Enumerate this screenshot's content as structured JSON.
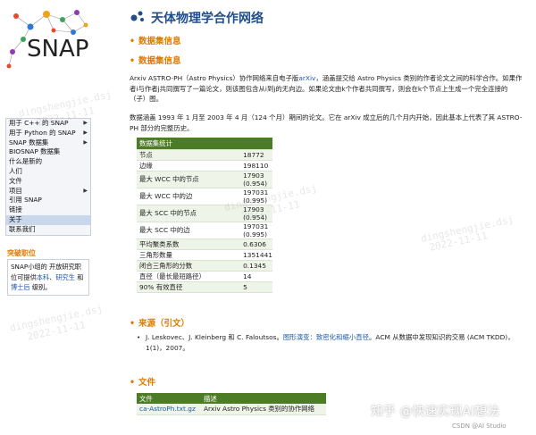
{
  "left": {
    "logo_text": "SNAP",
    "menu": [
      {
        "label": "用于 C++ 的 SNAP",
        "has_arrow": true
      },
      {
        "label": "用于 Python 的 SNAP",
        "has_arrow": true
      },
      {
        "label": "SNAP 数据集",
        "has_arrow": true
      },
      {
        "label": "BIOSNAP 数据集",
        "has_arrow": false
      },
      {
        "label": "什么是新的",
        "has_arrow": false
      },
      {
        "label": "人们",
        "has_arrow": false
      },
      {
        "label": "文件",
        "has_arrow": false
      },
      {
        "label": "项目",
        "has_arrow": true
      },
      {
        "label": "引用 SNAP",
        "has_arrow": false
      },
      {
        "label": "链接",
        "has_arrow": false
      },
      {
        "label": "关于",
        "has_arrow": false
      },
      {
        "label": "联系我们",
        "has_arrow": false
      }
    ],
    "news_title": "突破职位",
    "news_pre": "SNAP小组的 开放研究职位可提供",
    "news_link1": "本科",
    "news_sep": "、",
    "news_link2": "研究生",
    "news_mid": " 和 ",
    "news_link3": "博士后",
    "news_post": " 级别。"
  },
  "main": {
    "title": "天体物理学合作网络",
    "sec1": "数据集信息",
    "sec2": "数据集信息",
    "para1_a": "Arxiv ASTRO-PH（Astro Physics）协作网络来自电子版",
    "para1_link": "arXiv",
    "para1_b": "，涵盖提交给 Astro Physics 类别的作者论文之间的科学合作。如果作者i与作者j共同撰写了一篇论文，则该图包含从i到j的无向边。如果论文由k个作者共同撰写，则会在k个节点上生成一个完全连接的（子）图。",
    "para2": "数据涵盖 1993 年 1 月至 2003 年 4 月（124 个月）期间的论文。它在 arXiv 成立后的几个月内开始，因此基本上代表了其 ASTRO-PH 部分的完整历史。",
    "stats_header": "数据集统计",
    "stats": [
      {
        "k": "节点",
        "v": "18772"
      },
      {
        "k": "边缘",
        "v": "198110"
      },
      {
        "k": "最大 WCC 中的节点",
        "v": "17903 (0.954)"
      },
      {
        "k": "最大 WCC 中的边",
        "v": "197031 (0.995)"
      },
      {
        "k": "最大 SCC 中的节点",
        "v": "17903 (0.954)"
      },
      {
        "k": "最大 SCC 中的边",
        "v": "197031 (0.995)"
      },
      {
        "k": "平均聚类系数",
        "v": "0.6306"
      },
      {
        "k": "三角形数量",
        "v": "1351441"
      },
      {
        "k": "闭合三角形的分数",
        "v": "0.1345"
      },
      {
        "k": "直径（最长最短路径）",
        "v": "14"
      },
      {
        "k": "90% 有效直径",
        "v": "5"
      }
    ],
    "sec3": "来源（引文）",
    "ref_a": "J. Leskovec、J. Kleinberg 和 C. Faloutsos。",
    "ref_link": "图形演变：致密化和缩小直径",
    "ref_b": "。ACM 从数据中发现知识的交易 (ACM TKDD)，1(1)，2007。",
    "sec4": "文件",
    "files_header": [
      "文件",
      "描述"
    ],
    "files": [
      {
        "file": "ca-AstroPh.txt.gz",
        "desc": "Arxiv Astro Physics 类别的协作网络"
      }
    ]
  },
  "watermark": [
    "dingshengjie.dsj",
    "2022-11-11"
  ],
  "zhihu": "知乎 @快速实现AI想法",
  "csdn": "CSDN @AI Studio",
  "colors": {
    "accent": "#e07a00",
    "title": "#1f4e8a",
    "table_header": "#4d7c26",
    "link": "#1a5aa8"
  }
}
